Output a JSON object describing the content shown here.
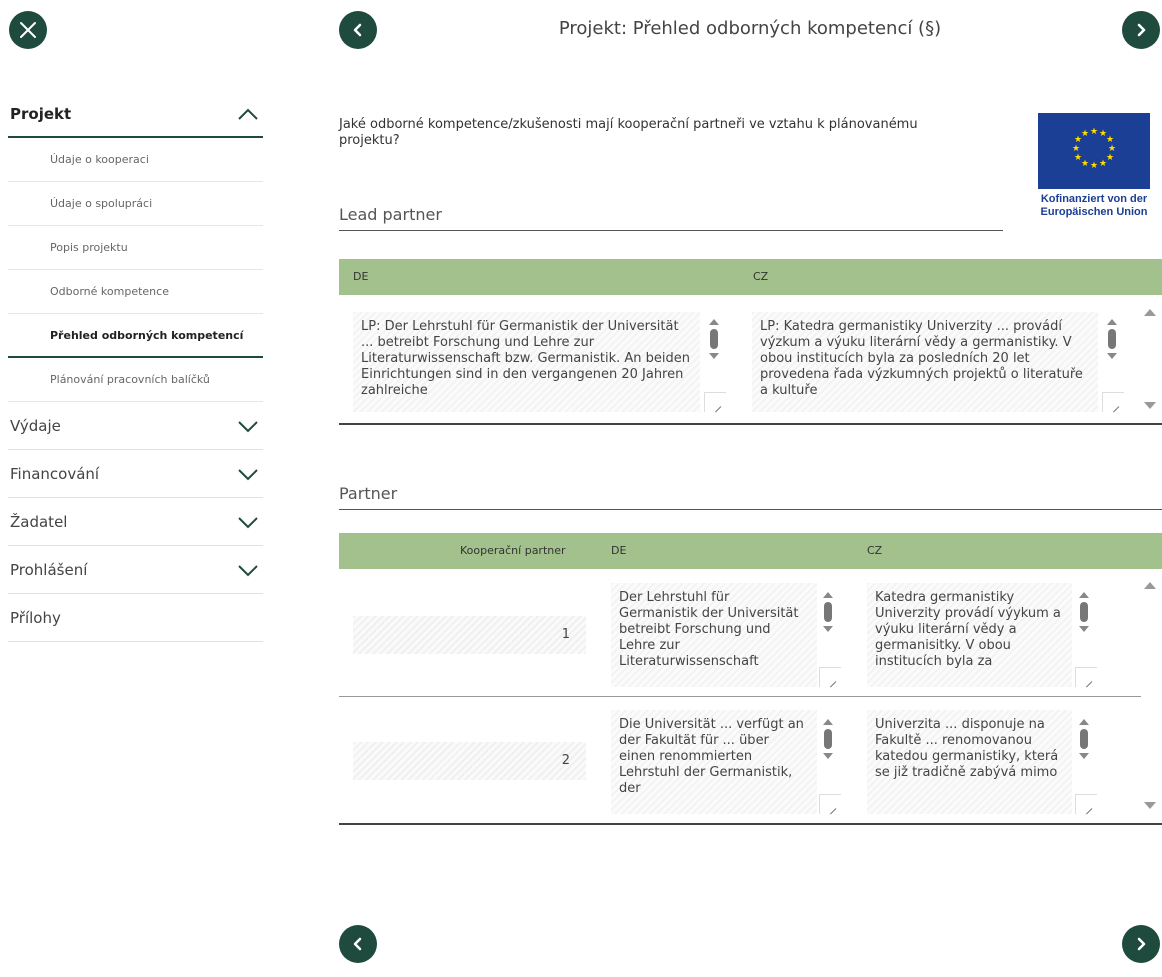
{
  "header": {
    "title": "Projekt: Přehled odborných kompetencí (§)",
    "close_icon": "close-icon",
    "prev_icon": "chevron-left-icon",
    "next_icon": "chevron-right-icon"
  },
  "sidebar": {
    "sections": [
      {
        "label": "Projekt",
        "expanded": true,
        "items": [
          {
            "label": "Údaje o kooperaci"
          },
          {
            "label": "Údaje o spolupráci"
          },
          {
            "label": "Popis projektu"
          },
          {
            "label": "Odborné kompetence"
          },
          {
            "label": "Přehled odborných kompetencí",
            "active": true
          },
          {
            "label": "Plánování pracovních balíčků"
          }
        ]
      },
      {
        "label": "Výdaje"
      },
      {
        "label": "Financování"
      },
      {
        "label": "Žadatel"
      },
      {
        "label": "Prohlášení"
      },
      {
        "label": "Přílohy"
      }
    ]
  },
  "main": {
    "question": "Jaké odborné kompetence/zkušenosti mají kooperační partneři ve vztahu k plánovanému projektu?",
    "eu_logo_text": "Kofinanziert von der Europäischen Union",
    "lead_partner": {
      "title": "Lead partner",
      "col_de": "DE",
      "col_cz": "CZ",
      "de_text": "LP: Der Lehrstuhl für Germanistik der Universität ... betreibt Forschung und Lehre zur Literaturwissenschaft bzw. Germanistik. An beiden Einrichtungen sind in den vergangenen 20 Jahren zahlreiche",
      "cz_text": "LP: Katedra germanistiky Univerzity ... provádí výzkum a výuku literární vědy a germanistiky. V obou institucích byla za posledních 20 let provedena řada výzkumných projektů o literatuře a kultuře"
    },
    "partner": {
      "title": "Partner",
      "col_partner": "Kooperační partner",
      "col_de": "DE",
      "col_cz": "CZ",
      "rows": [
        {
          "number": "1",
          "de_text": "Der Lehrstuhl für Germanistik der Universität betreibt Forschung und Lehre zur Literaturwissenschaft",
          "cz_text": "Katedra germanistiky Univerzity provádí výykum a výuku literární vědy a germanisitky. V obou institucích byla za"
        },
        {
          "number": "2",
          "de_text": "Die Universität ... verfügt an der Fakultät für ... über einen renommierten Lehrstuhl der Germanistik, der",
          "cz_text": "Univerzita ... disponuje na Fakultě ... renomovanou katedou germanistiky, která se již tradičně zabývá mimo"
        }
      ]
    }
  },
  "colors": {
    "dark_green": "#1f4a3e",
    "table_header": "#a3c18c",
    "eu_blue": "#1b3f94",
    "eu_star": "#ffdd00"
  }
}
